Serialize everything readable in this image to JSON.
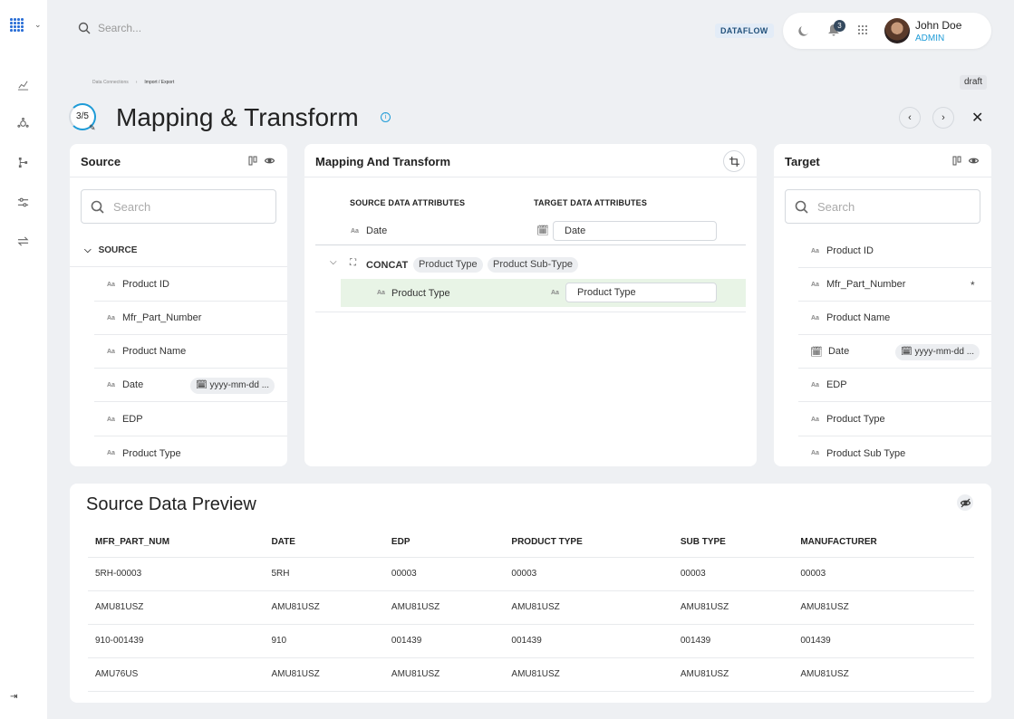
{
  "header": {
    "search_placeholder": "Search...",
    "app_badge": "DATAFLOW",
    "notifications_count": "3",
    "user_name": "John Doe",
    "user_role": "ADMIN"
  },
  "breadcrumb": [
    "Data Connections",
    "Import / Export"
  ],
  "status_badge": "draft",
  "step": "3/5",
  "page_title": "Mapping & Transform",
  "source": {
    "title": "Source",
    "search_placeholder": "Search",
    "group_label": "SOURCE",
    "items": [
      {
        "label": "Product ID"
      },
      {
        "label": "Mfr_Part_Number"
      },
      {
        "label": "Product Name"
      },
      {
        "label": "Date",
        "format": "yyyy-mm-dd ..."
      },
      {
        "label": "EDP"
      },
      {
        "label": "Product Type"
      }
    ]
  },
  "mapping": {
    "title": "Mapping And Transform",
    "col_source": "SOURCE DATA ATTRIBUTES",
    "col_target": "TARGET DATA ATTRIBUTES",
    "row1": {
      "source": "Date",
      "target": "Date"
    },
    "concat": {
      "label": "CONCAT",
      "chips": [
        "Product Type",
        "Product Sub-Type"
      ]
    },
    "row2": {
      "source": "Product Type",
      "target": "Product Type"
    }
  },
  "target": {
    "title": "Target",
    "search_placeholder": "Search",
    "items": [
      {
        "label": "Product ID"
      },
      {
        "label": "Mfr_Part_Number",
        "required": "*"
      },
      {
        "label": "Product Name"
      },
      {
        "label": "Date",
        "format": "yyyy-mm-dd ..."
      },
      {
        "label": "EDP"
      },
      {
        "label": "Product Type"
      },
      {
        "label": "Product Sub Type"
      }
    ]
  },
  "preview": {
    "title": "Source Data Preview",
    "columns": [
      "MFR_PART_NUM",
      "DATE",
      "EDP",
      "PRODUCT TYPE",
      "SUB TYPE",
      "MANUFACTURER"
    ],
    "rows": [
      [
        "5RH-00003",
        "5RH",
        "00003",
        "00003",
        "00003",
        "00003"
      ],
      [
        "AMU81USZ",
        "AMU81USZ",
        "AMU81USZ",
        "AMU81USZ",
        "AMU81USZ",
        "AMU81USZ"
      ],
      [
        "910-001439",
        "910",
        "001439",
        "001439",
        "001439",
        "001439"
      ],
      [
        "AMU76US",
        "AMU81USZ",
        "AMU81USZ",
        "AMU81USZ",
        "AMU81USZ",
        "AMU81USZ"
      ]
    ]
  }
}
